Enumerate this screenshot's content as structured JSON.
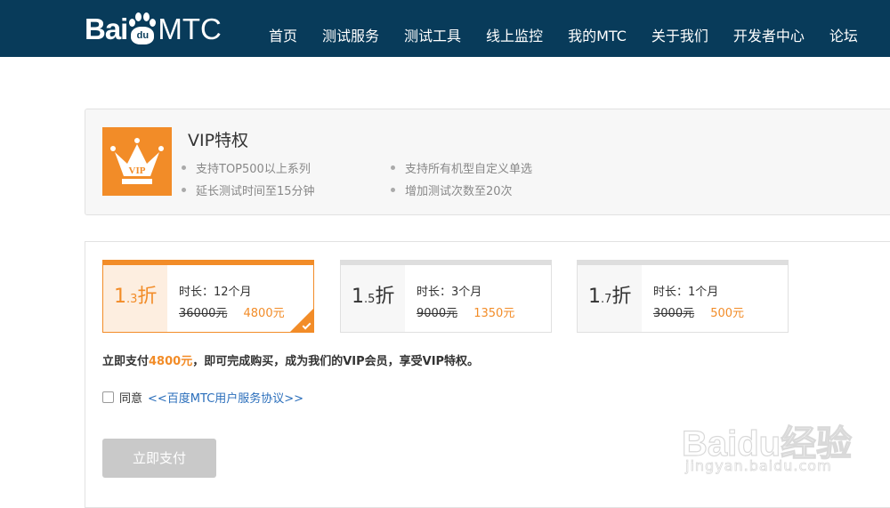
{
  "header": {
    "logo": {
      "part1": "Bai",
      "part2": "du",
      "part3": "MTC"
    },
    "nav": [
      "首页",
      "测试服务",
      "测试工具",
      "线上监控",
      "我的MTC",
      "关于我们",
      "开发者中心",
      "论坛"
    ]
  },
  "vip": {
    "badge_text": "VIP",
    "title": "VIP特权",
    "features": [
      "支持TOP500以上系列",
      "延长测试时间至15分钟",
      "支持所有机型自定义单选",
      "增加测试次数至20次"
    ]
  },
  "plans": [
    {
      "disc_main": "1",
      "disc_small": ".3",
      "disc_unit": "折",
      "duration": "时长：12个月",
      "old_price": "36000元",
      "new_price": "4800元",
      "selected": true
    },
    {
      "disc_main": "1",
      "disc_small": ".5",
      "disc_unit": "折",
      "duration": "时长：3个月",
      "old_price": "9000元",
      "new_price": "1350元",
      "selected": false
    },
    {
      "disc_main": "1",
      "disc_small": ".7",
      "disc_unit": "折",
      "duration": "时长：1个月",
      "old_price": "3000元",
      "new_price": "500元",
      "selected": false
    }
  ],
  "payment": {
    "note_prefix": "立即支付",
    "note_amount": "4800元",
    "note_suffix": "，即可完成购买，成为我们的VIP会员，享受VIP特权。",
    "agree_label": "同意",
    "agreement_link": "<<百度MTC用户服务协议>>",
    "pay_button": "立即支付"
  },
  "watermark": {
    "text": "Baidu经验",
    "url": "jingyan.baidu.com"
  },
  "colors": {
    "header_bg": "#083b5a",
    "accent": "#f28c28",
    "link": "#2a6ebb",
    "disabled_button": "#c9c9c9"
  }
}
